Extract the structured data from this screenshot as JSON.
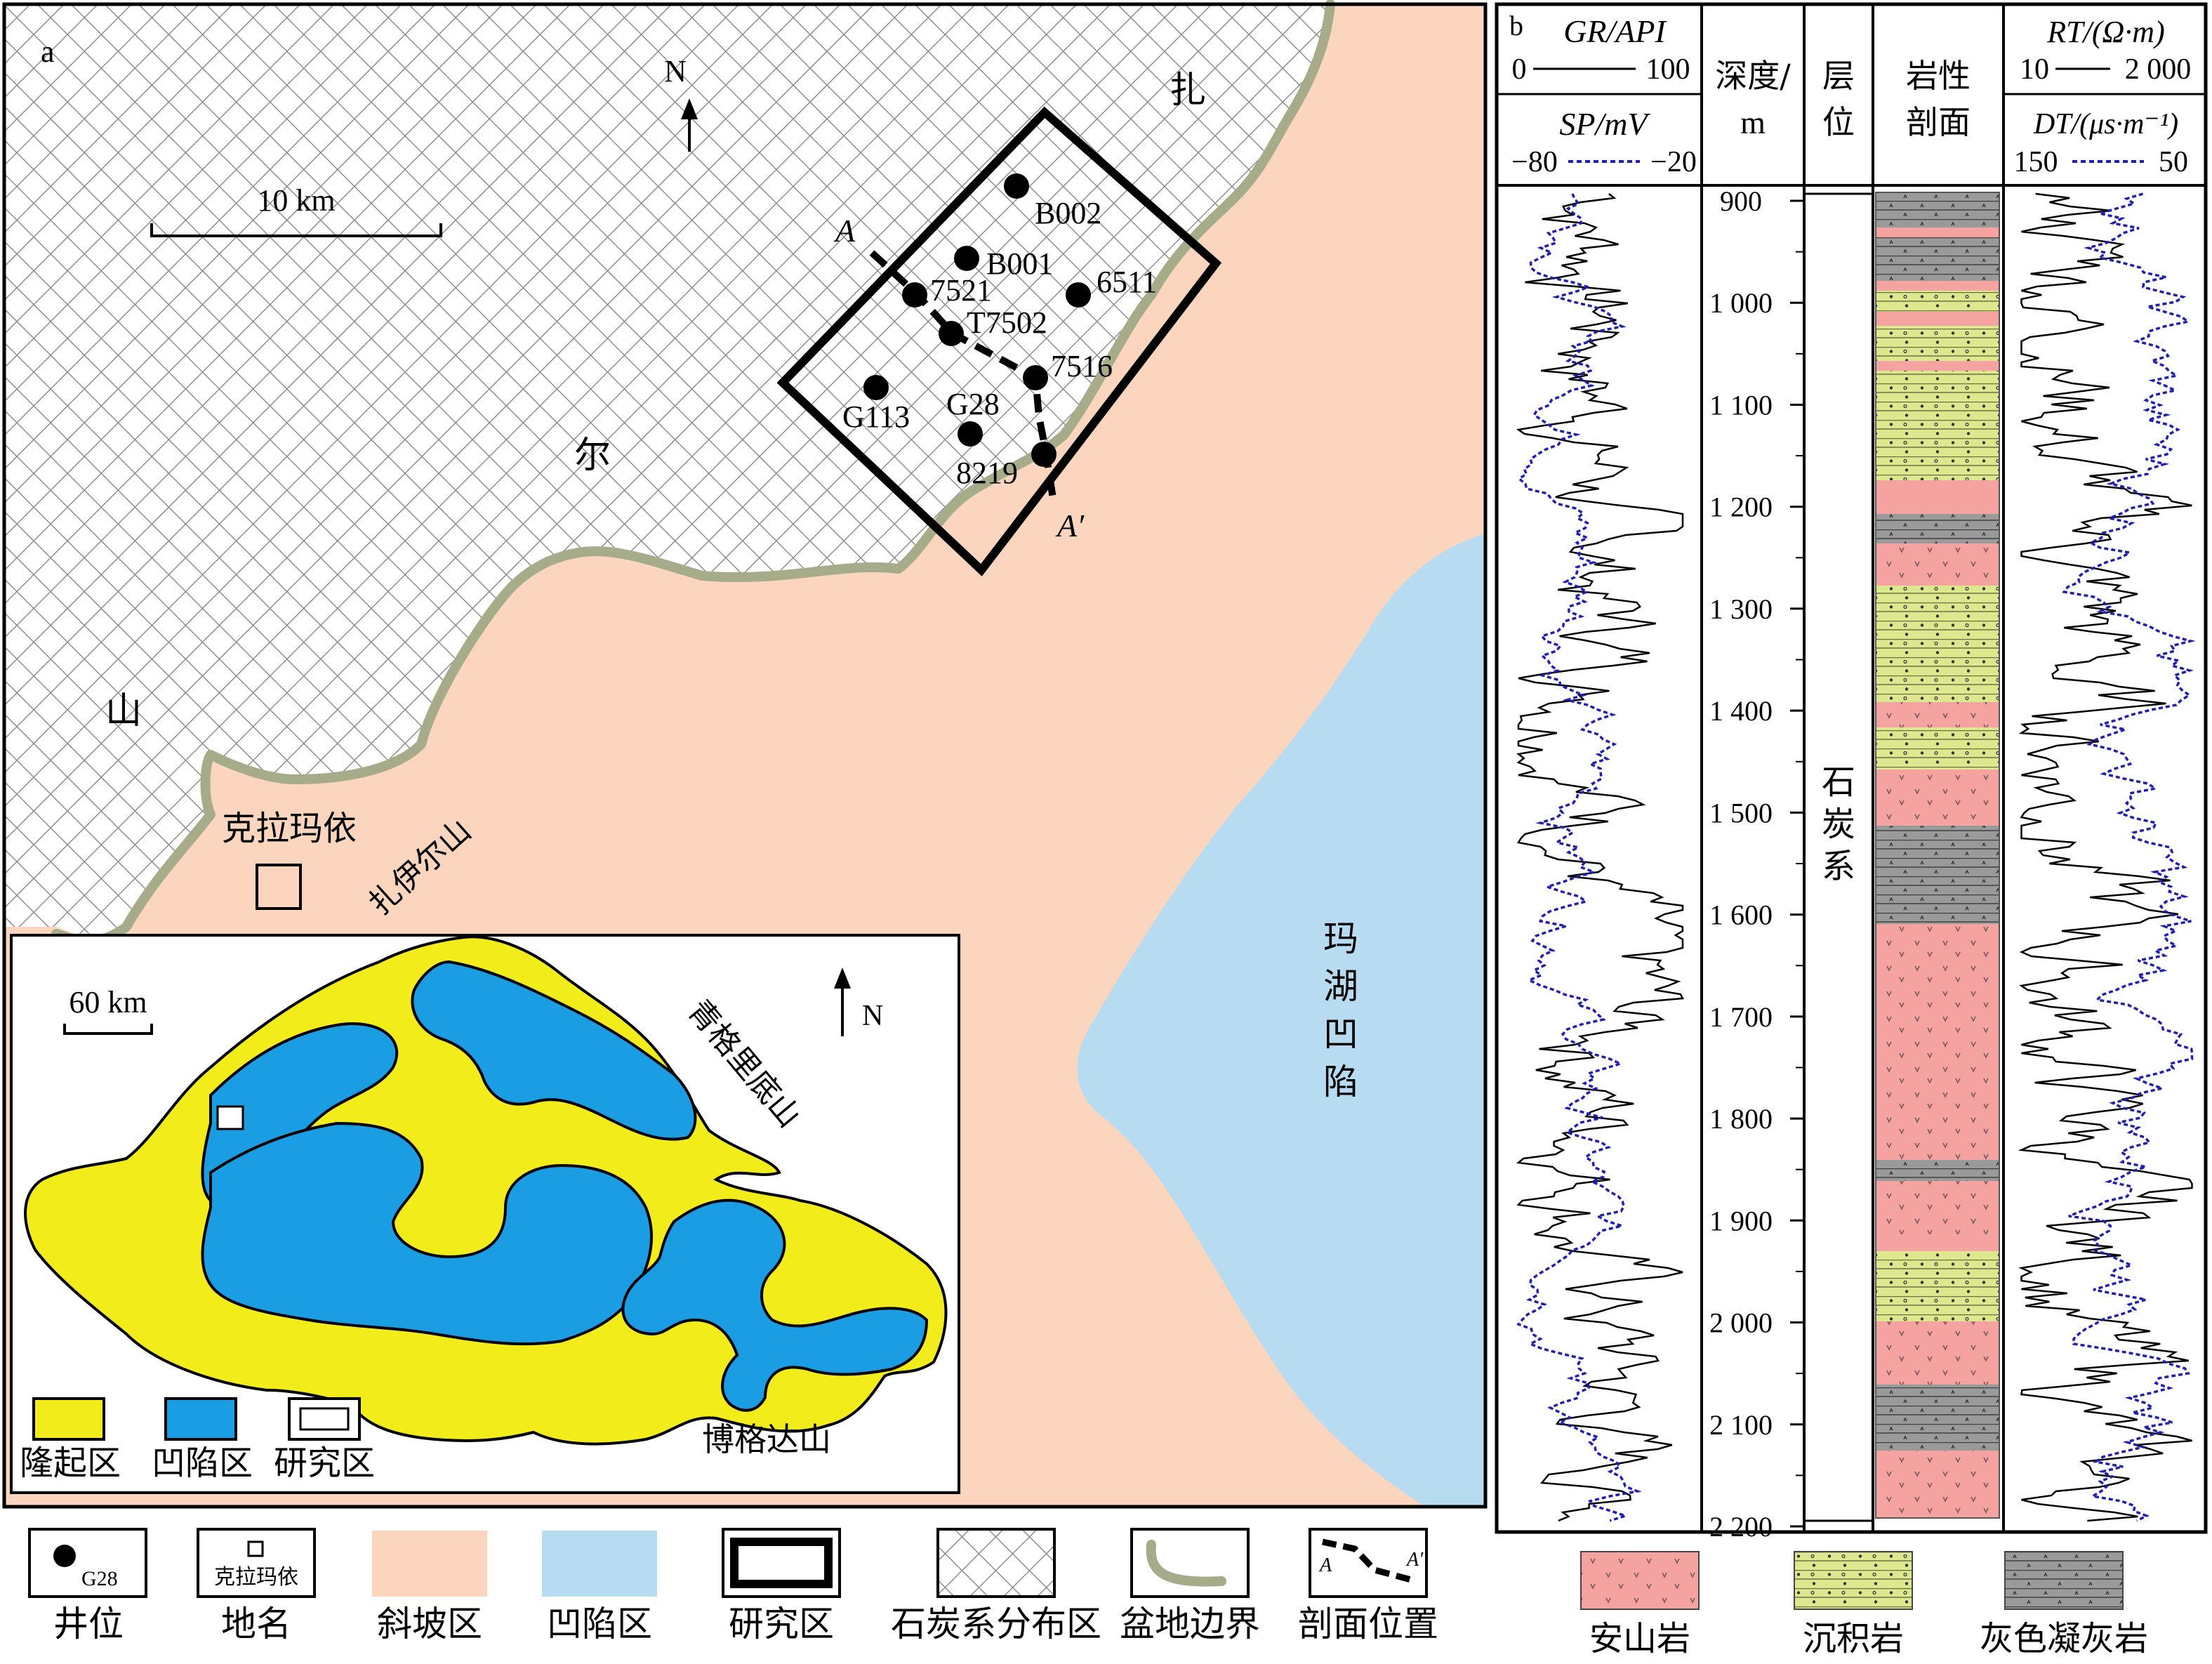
{
  "panel_a": {
    "label": "a",
    "north": "N",
    "scale": "10 km",
    "mountain_chars": [
      "扎",
      "尔",
      "山"
    ],
    "place": "克拉玛依",
    "depression_chars": [
      "玛",
      "湖",
      "凹",
      "陷"
    ],
    "section_start": "A",
    "section_end": "A′",
    "wells": [
      "B002",
      "B001",
      "7521",
      "6511",
      "T7502",
      "7516",
      "G113",
      "G28",
      "8219"
    ]
  },
  "inset": {
    "scale": "60 km",
    "north": "N",
    "mountains": [
      "扎伊尔山",
      "青格里底山",
      "博格达山"
    ],
    "legend": [
      "隆起区",
      "凹陷区",
      "研究区"
    ]
  },
  "legend_a": {
    "items": [
      "井位",
      "地名",
      "斜坡区",
      "凹陷区",
      "研究区",
      "石炭系分布区",
      "盆地边界",
      "剖面位置"
    ],
    "well_symbol_label": "G28",
    "place_symbol_label": "克拉玛依"
  },
  "panel_b": {
    "label": "b",
    "gr": {
      "label": "GR/API",
      "min": "0",
      "max": "100"
    },
    "sp": {
      "label": "SP/mV",
      "min": "−80",
      "max": "−20"
    },
    "depth_header": [
      "深度/",
      "m"
    ],
    "strata_header": [
      "层",
      "位"
    ],
    "litho_header": [
      "岩性",
      "剖面"
    ],
    "rt": {
      "label": "RT/(Ω·m)",
      "min": "10",
      "max": "2 000"
    },
    "dt": {
      "label": "DT/(μs·m⁻¹)",
      "min": "150",
      "max": "50"
    },
    "depth_ticks": [
      "900",
      "1 000",
      "1 100",
      "1 200",
      "1 300",
      "1 400",
      "1 500",
      "1 600",
      "1 700",
      "1 800",
      "1 900",
      "2 000",
      "2 100",
      "2 200"
    ],
    "formation": [
      "石",
      "炭",
      "系"
    ],
    "lithology_legend": [
      "安山岩",
      "沉积岩",
      "灰色凝灰岩"
    ],
    "colors": {
      "andesite": "#f4a3a0",
      "sediment": "#dde88e",
      "tuff": "#9a9a9a",
      "slope": "#fbd5bd",
      "depression": "#b7dcf2",
      "uplift": "#f3ec1b",
      "inset_depression": "#1a9de2",
      "boundary": "#a6ac8a"
    }
  }
}
